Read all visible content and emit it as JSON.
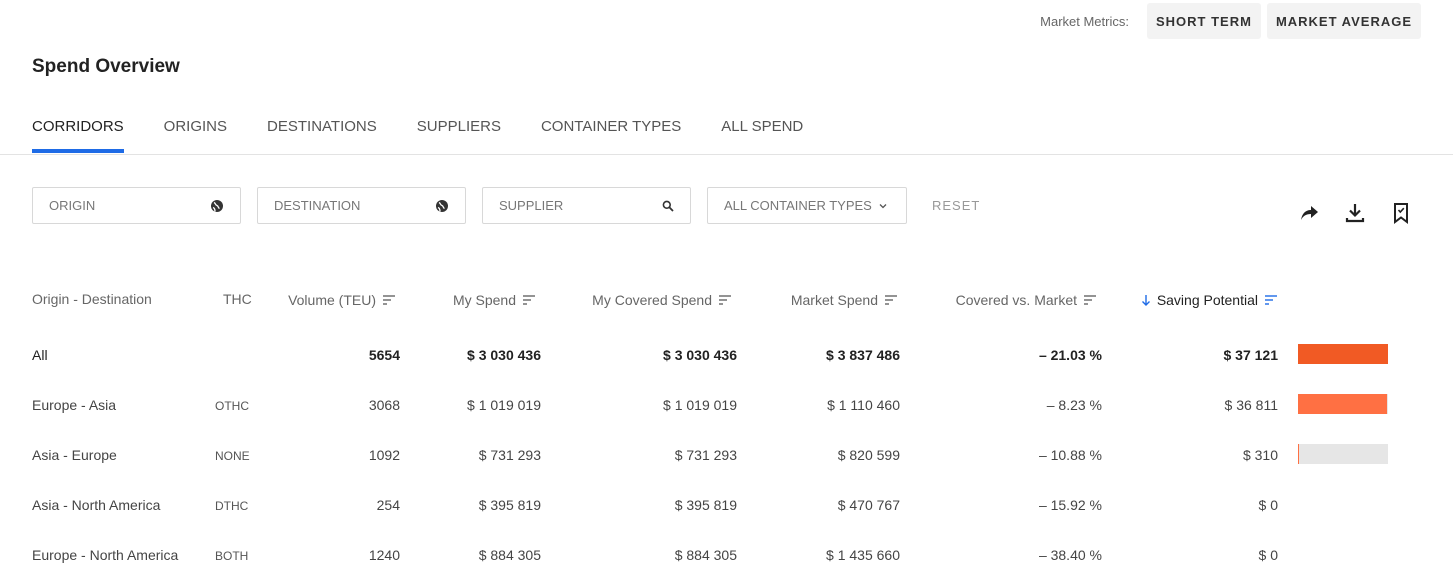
{
  "market_metrics": {
    "label": "Market Metrics:",
    "buttons": [
      "SHORT TERM",
      "MARKET AVERAGE"
    ]
  },
  "page_title": "Spend Overview",
  "tabs": [
    {
      "label": "CORRIDORS",
      "active": true
    },
    {
      "label": "ORIGINS",
      "active": false
    },
    {
      "label": "DESTINATIONS",
      "active": false
    },
    {
      "label": "SUPPLIERS",
      "active": false
    },
    {
      "label": "CONTAINER TYPES",
      "active": false
    },
    {
      "label": "ALL SPEND",
      "active": false
    }
  ],
  "filters": {
    "origin_placeholder": "ORIGIN",
    "destination_placeholder": "DESTINATION",
    "supplier_placeholder": "SUPPLIER",
    "container_select": "ALL CONTAINER TYPES",
    "reset_label": "RESET"
  },
  "icons": {
    "origin": "globe-icon",
    "destination": "globe-icon",
    "supplier": "search-icon",
    "share": "share-icon",
    "download": "download-icon",
    "bookmark": "bookmark-icon",
    "sort": "sort-lines-icon",
    "sort_active": "arrow-down-icon"
  },
  "colors": {
    "accent": "#1e6be6",
    "bar_strong": "#f15a24",
    "bar_medium": "#ff7043",
    "bar_track": "#e6e6e6"
  },
  "table": {
    "headers": {
      "route": "Origin - Destination",
      "thc": "THC",
      "volume": "Volume (TEU)",
      "my_spend": "My Spend",
      "my_covered": "My Covered Spend",
      "market_spend": "Market Spend",
      "covered_vs_market": "Covered vs. Market",
      "saving": "Saving Potential"
    },
    "rows": [
      {
        "route": "All",
        "thc": "",
        "volume": "5654",
        "my_spend": "$ 3 030 436",
        "my_covered": "$ 3 030 436",
        "market_spend": "$ 3 837 486",
        "covered_vs_market": "– 21.03 %",
        "saving": "$ 37 121",
        "saving_fraction": 1.0,
        "bar_color": "#f15a24"
      },
      {
        "route": "Europe - Asia",
        "thc": "OTHC",
        "volume": "3068",
        "my_spend": "$ 1 019 019",
        "my_covered": "$ 1 019 019",
        "market_spend": "$ 1 110 460",
        "covered_vs_market": "– 8.23 %",
        "saving": "$ 36 811",
        "saving_fraction": 0.99,
        "bar_color": "#ff7043"
      },
      {
        "route": "Asia - Europe",
        "thc": "NONE",
        "volume": "1092",
        "my_spend": "$ 731 293",
        "my_covered": "$ 731 293",
        "market_spend": "$ 820 599",
        "covered_vs_market": "– 10.88 %",
        "saving": "$ 310",
        "saving_fraction": 0.01,
        "bar_color": "#ff7043"
      },
      {
        "route": "Asia - North America",
        "thc": "DTHC",
        "volume": "254",
        "my_spend": "$ 395 819",
        "my_covered": "$ 395 819",
        "market_spend": "$ 470 767",
        "covered_vs_market": "– 15.92 %",
        "saving": "$ 0",
        "saving_fraction": 0,
        "bar_color": ""
      },
      {
        "route": "Europe - North America",
        "thc": "BOTH",
        "volume": "1240",
        "my_spend": "$ 884 305",
        "my_covered": "$ 884 305",
        "market_spend": "$ 1 435 660",
        "covered_vs_market": "– 38.40 %",
        "saving": "$ 0",
        "saving_fraction": 0,
        "bar_color": ""
      }
    ]
  }
}
